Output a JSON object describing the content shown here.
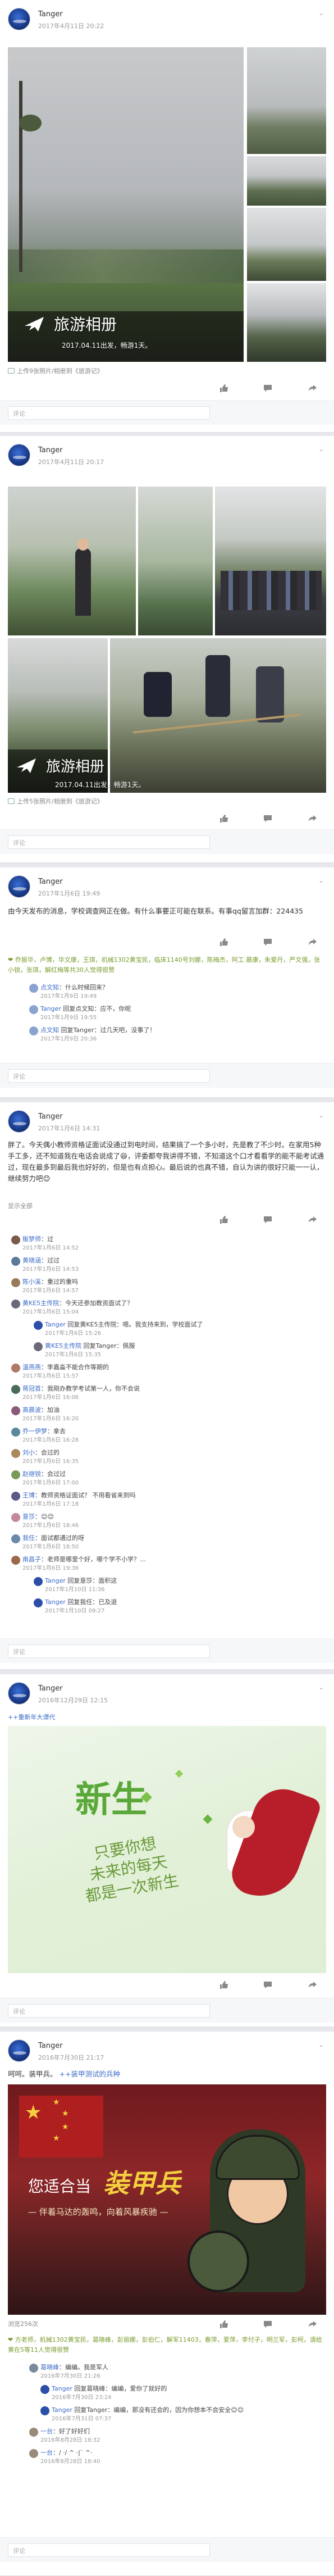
{
  "posts": [
    {
      "user": "Tanger",
      "time": "2017年4月11日 20:22",
      "album_title": "旅游相册",
      "album_sub": "2017.04.11出发，畅游1天。",
      "source": "上传9张照片/相册到《旅游记》",
      "comment_placeholder": "评论"
    },
    {
      "user": "Tanger",
      "time": "2017年4月11日 20:17",
      "album_title": "旅游相册",
      "album_sub": "2017.04.11出发，畅游1天。",
      "source": "上传5张照片/相册到《旅游记》",
      "comment_placeholder": "评论"
    },
    {
      "user": "Tanger",
      "time": "2017年1月6日 19:49",
      "text": "由今天发布的消息，学校调查网正在做。有什么事要正可能在联系。有事qq留言加群：224435",
      "likes": "❤ 乔振华，卢博，华文康，王琪，机械1302黄宝民，临床1140号刘娜，陈梅杰，阿工 晨康，朱爱丹，严文强，张小锐，张琪，解红梅等共30人觉得很赞",
      "comments": [
        {
          "name": "点文知",
          "text": "：什么时候回来？",
          "time": "2017年1月9日 19:49"
        },
        {
          "name": "Tanger",
          "text": " 回复点文知：应不，你呢",
          "time": "2017年1月9日 19:55"
        },
        {
          "name": "点文知",
          "text": " 回复Tanger：过几天吧，没事了！",
          "time": "2017年1月9日 20:36"
        }
      ],
      "comment_placeholder": "评论"
    },
    {
      "user": "Tanger",
      "time": "2017年1月6日 14:31",
      "text": "胖了。今天偶小教师资格证面试没通过到电时间，结果搞了一个多小时，先是教了不少时。在家用5种手工多，还不知道我在电话会说成了😆，评委都夸我讲得不错，不知道这个口才看看学的能不能考试通过，现在最多到最后我也好好的，但是也有点担心。最后说的也真不错，自认为讲的很好只能一一认，继续努力吧😊",
      "more": "显示全部",
      "commenters": [
        {
          "name": "贩梦师",
          "text": "：过",
          "time": "2017年1月6日 14:52"
        },
        {
          "name": "黄晓涵",
          "text": "：过过",
          "time": "2017年1月6日 14:53"
        },
        {
          "name": "陈小溪",
          "text": "：重过的重吗",
          "time": "2017年1月6日 14:57"
        },
        {
          "name": "黄KE5主传院",
          "text": "：今天还参加教资面试了？",
          "time": "2017年1月6日 15:04"
        },
        {
          "name": "Tanger",
          "text": " 回复黄KE5主传院：嗯。我支持来到，学校面试了",
          "time": "2017年1月6日 15:26"
        },
        {
          "name": "黄KE5主传院",
          "text": " 回复Tanger：佩服",
          "time": "2017年1月6日 15:35"
        },
        {
          "name": "温燕燕",
          "text": "：李嘉淼不能合作等期的",
          "time": "2017年1月6日 15:57"
        },
        {
          "name": "蒋冠首",
          "text": "：我刚办教学考试第一人，你不会说",
          "time": "2017年1月6日 16:06"
        },
        {
          "name": "高晨波",
          "text": "：加油",
          "time": "2017年1月6日 16:20"
        },
        {
          "name": "乔一伊梦",
          "text": "：拿去",
          "time": "2017年1月6日 16:28"
        },
        {
          "name": "刘小",
          "text": "：会过的",
          "time": "2017年1月6日 16:35"
        },
        {
          "name": "赵继锐",
          "text": "：会过过",
          "time": "2017年1月6日 17:00"
        },
        {
          "name": "王博",
          "text": "：教师资格证面试？ 不用看省来到吗",
          "time": "2017年1月6日 17:18"
        },
        {
          "name": "意莎",
          "text": "：😊😊",
          "time": "2017年1月6日 18:46"
        },
        {
          "name": "我任",
          "text": "：面试都通过的呀",
          "time": "2017年1月6日 18:50"
        },
        {
          "name": "南昌子",
          "text": "：老师是哪里个好，哪个学不小学？…",
          "time": "2017年1月6日 19:36"
        },
        {
          "name": "Tanger",
          "text": " 回复意莎：面积这",
          "time": "2017年1月10日 11:36"
        },
        {
          "name": "Tanger",
          "text": " 回复我任：已及退",
          "time": "2017年1月10日 09:27"
        }
      ],
      "comment_placeholder": "评论"
    },
    {
      "user": "Tanger",
      "time": "2016年12月29日 12:15",
      "share": "++重新年大谭代",
      "banner_text": "新生",
      "poem_1": "只要你想",
      "poem_2": "未来的每天",
      "poem_3": "都是一次新生",
      "comment_placeholder": "评论"
    },
    {
      "user": "Tanger",
      "time": "2016年7月30日 21:17",
      "text": "呵呵。装甲兵。",
      "share": "++装甲测试的兵种",
      "ad_line1": "您适合当",
      "ad_line2": "装甲兵",
      "ad_line3": "— 伴着马达的轰鸣，向着风暴疾驰 —",
      "views": "浏览256次",
      "likes": "❤ 方老师，机械1302黄宝民，葛晓峰，彭丽娜，彭伯仁，解军11403，春萍，爱萍，李付子，明兰军，彭柯，请给黄在5等11人觉得很赞",
      "comments": [
        {
          "name": "葛晓峰",
          "text": "：编编。我是军人",
          "time": "2016年7月30日 21:26"
        },
        {
          "name": "Tanger",
          "text": " 回复葛晓峰：编编，爱你了就好的",
          "time": "2016年7月30日 23:24"
        },
        {
          "name": "Tanger",
          "text": " 回复Tanger：编编，那没有还会的，因为你想本不会安全😊😊",
          "time": "2016年7月31日 07:37"
        },
        {
          "name": "一台",
          "text": "：好了好好们",
          "time": "2016年8月28日 18:32"
        },
        {
          "name": "一台",
          "text": "：/ ·/ ^ ·|` ^·",
          "time": "2016年8月28日 18:40"
        }
      ],
      "comment_placeholder": "评论"
    }
  ],
  "colors": {
    "link": "#3b6cc9",
    "like_green": "#7a9c2e",
    "action_bar": "#f6f7f9"
  },
  "icons": [
    "chevron-down-icon",
    "thumbs-up-icon",
    "comment-icon",
    "share-icon",
    "airplane-icon",
    "heart-icon"
  ]
}
